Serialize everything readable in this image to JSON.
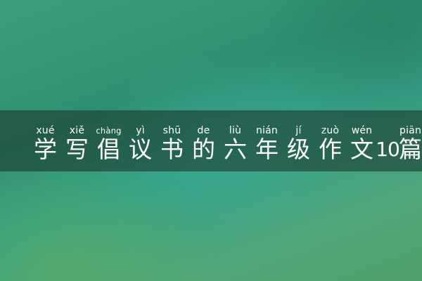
{
  "title": {
    "characters": [
      {
        "pinyin": "xué",
        "hanzi": "学"
      },
      {
        "pinyin": "xiě",
        "hanzi": "写"
      },
      {
        "pinyin": "chàng",
        "hanzi": "倡"
      },
      {
        "pinyin": "yì",
        "hanzi": "议"
      },
      {
        "pinyin": "shū",
        "hanzi": "书"
      },
      {
        "pinyin": "de",
        "hanzi": "的"
      },
      {
        "pinyin": "liù",
        "hanzi": "六"
      },
      {
        "pinyin": "nián",
        "hanzi": "年"
      },
      {
        "pinyin": "jí",
        "hanzi": "级"
      },
      {
        "pinyin": "zuò",
        "hanzi": "作"
      },
      {
        "pinyin": "wén",
        "hanzi": "文"
      },
      {
        "pinyin": "",
        "hanzi": "10"
      },
      {
        "pinyin": "piān",
        "hanzi": "篇"
      }
    ]
  },
  "colors": {
    "text": "#ffffff",
    "band": "#1c3c30",
    "background": "#36a288"
  }
}
